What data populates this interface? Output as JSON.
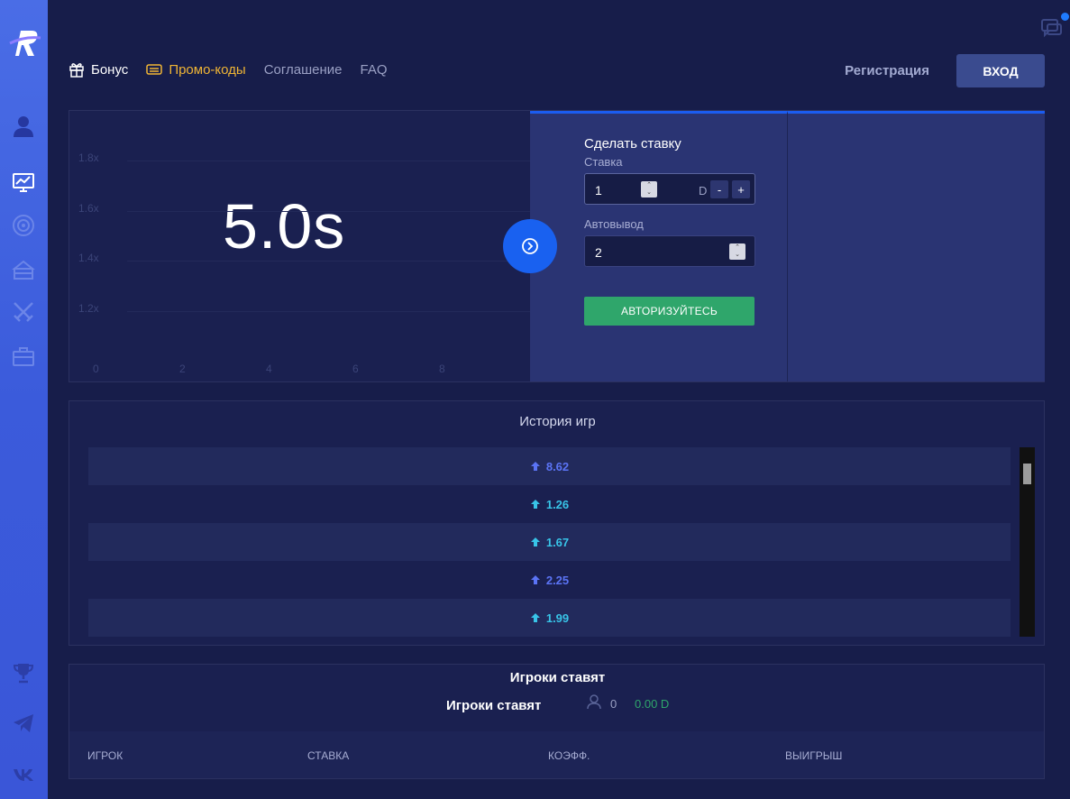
{
  "nav": {
    "bonus": "Бонус",
    "promo": "Промо-коды",
    "agreement": "Соглашение",
    "faq": "FAQ",
    "register": "Регистрация",
    "login": "ВХОД"
  },
  "chart_data": {
    "type": "line",
    "y_ticks": [
      "1.8x",
      "1.6x",
      "1.4x",
      "1.2x"
    ],
    "x_ticks": [
      "0",
      "2",
      "4",
      "6",
      "8"
    ],
    "series": [],
    "timer": "5.0s"
  },
  "bet": {
    "title": "Сделать ставку",
    "stake_label": "Ставка",
    "stake_value": "1",
    "currency": "D",
    "minus": "-",
    "plus": "+",
    "autocash_label": "Автовывод",
    "autocash_value": "2",
    "auth_button": "АВТОРИЗУЙТЕСЬ"
  },
  "history": {
    "title": "История игр",
    "items": [
      {
        "value": "8.62",
        "color": "#5b74f5"
      },
      {
        "value": "1.26",
        "color": "#38c4e8"
      },
      {
        "value": "1.67",
        "color": "#38c4e8"
      },
      {
        "value": "2.25",
        "color": "#5b74f5"
      },
      {
        "value": "1.99",
        "color": "#38c4e8"
      }
    ]
  },
  "players": {
    "title": "Игроки ставят",
    "subtitle": "Игроки ставят",
    "count": "0",
    "sum": "0.00 D",
    "columns": [
      "ИГРОК",
      "СТАВКА",
      "КОЭФФ.",
      "ВЫИГРЫШ"
    ]
  },
  "colors": {
    "sidebar": "#3b5bdb",
    "accent_blue": "#1961f0",
    "promo": "#f0b535",
    "success": "#2fa66b"
  },
  "icons": [
    "logo-icon",
    "user-icon",
    "monitor-chart-icon",
    "target-icon",
    "treasure-icon",
    "swords-icon",
    "briefcase-icon",
    "trophy-icon",
    "telegram-icon",
    "vk-icon",
    "chat-icon"
  ]
}
